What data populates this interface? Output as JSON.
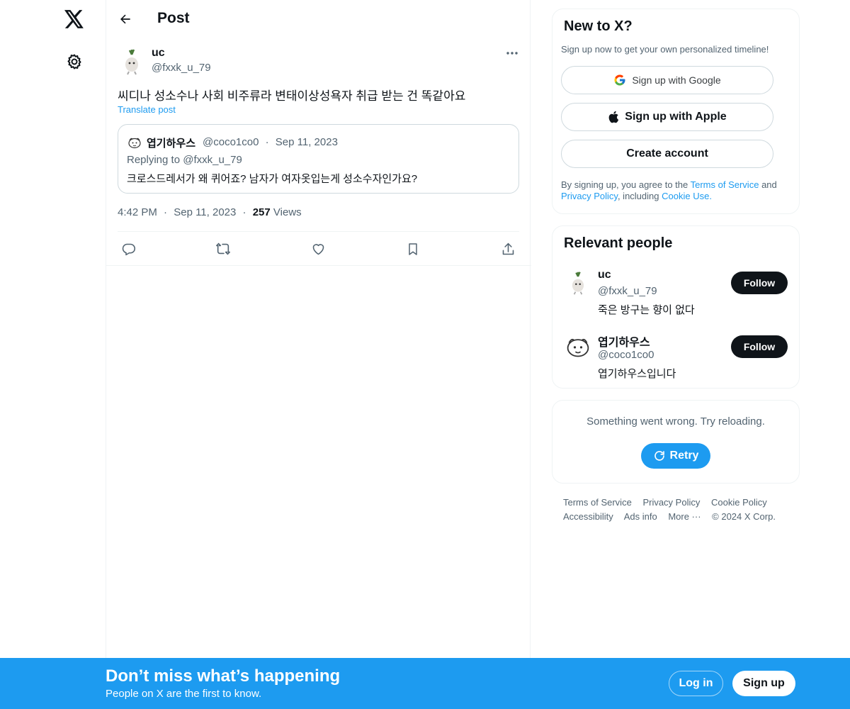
{
  "nav": {
    "logo_icon": "x-logo-icon",
    "settings_icon": "gear-icon"
  },
  "header": {
    "title": "Post",
    "back_icon": "arrow-left-icon"
  },
  "post": {
    "author_name": "uc",
    "author_handle": "@fxxk_u_79",
    "text": "씨디나 성소수나 사회 비주류라 변태이상성욕자 취급 받는 건 똑같아요",
    "translate_label": "Translate post",
    "quote": {
      "author_name": "엽기하우스",
      "author_handle": "@coco1co0",
      "separator": "·",
      "date": "Sep 11, 2023",
      "replying_to": "Replying to @fxxk_u_79",
      "text": "크로스드레서가 왜 퀴어죠? 남자가 여자옷입는게 성소수자인가요?"
    },
    "time": "4:42 PM",
    "date": "Sep 11, 2023",
    "views_count": "257",
    "views_label": "Views",
    "separator": "·"
  },
  "signup_card": {
    "title": "New to X?",
    "subtitle": "Sign up now to get your own personalized timeline!",
    "google_label": "Sign up with Google",
    "apple_label": "Sign up with Apple",
    "create_label": "Create account",
    "legal_prefix": "By signing up, you agree to the",
    "terms_link": "Terms of Service",
    "legal_and": "and",
    "privacy_link": "Privacy Policy",
    "legal_including": ", including",
    "cookie_link": "Cookie Use."
  },
  "relevant_people": {
    "title": "Relevant people",
    "people": [
      {
        "name": "uc",
        "handle": "@fxxk_u_79",
        "bio": "죽은 방구는 향이 없다",
        "follow_label": "Follow"
      },
      {
        "name": "엽기하우스",
        "handle": "@coco1co0",
        "bio": "엽기하우스입니다",
        "follow_label": "Follow"
      }
    ]
  },
  "error_card": {
    "message": "Something went wrong. Try reloading.",
    "retry_label": "Retry"
  },
  "footer": {
    "terms": "Terms of Service",
    "privacy": "Privacy Policy",
    "cookie": "Cookie Policy",
    "accessibility": "Accessibility",
    "ads": "Ads info",
    "more": "More ···",
    "copyright": "© 2024 X Corp."
  },
  "banner": {
    "title": "Don’t miss what’s happening",
    "subtitle": "People on X are the first to know.",
    "login_label": "Log in",
    "signup_label": "Sign up"
  },
  "colors": {
    "accent": "#1d9bf0",
    "text": "#0f1419",
    "muted": "#536471",
    "border": "#eff3f4"
  }
}
